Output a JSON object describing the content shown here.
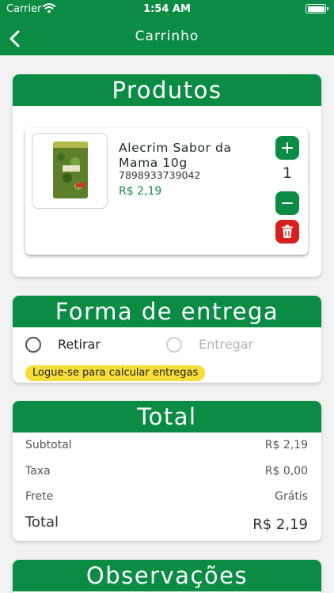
{
  "status_bar": {
    "carrier": "Carrier",
    "time": "1:54 AM"
  },
  "nav": {
    "title": "Carrinho"
  },
  "products_section": {
    "title": "Produtos",
    "items": [
      {
        "name": "Alecrim Sabor da Mama 10g",
        "code": "7898933739042",
        "price": "R$ 2,19",
        "quantity": "1"
      }
    ]
  },
  "delivery_section": {
    "title": "Forma de entrega",
    "options": [
      {
        "label": "Retirar",
        "enabled": true
      },
      {
        "label": "Entregar",
        "enabled": false
      }
    ],
    "login_notice": "Logue-se para calcular entregas"
  },
  "total_section": {
    "title": "Total",
    "rows": [
      {
        "label": "Subtotal",
        "value": "R$ 2,19"
      },
      {
        "label": "Taxa",
        "value": "R$ 0,00"
      },
      {
        "label": "Frete",
        "value": "Grátis"
      }
    ],
    "total": {
      "label": "Total",
      "value": "R$ 2,19"
    }
  },
  "notes_section": {
    "title": "Observações"
  },
  "colors": {
    "primary": "#0b8c44",
    "danger": "#d81f1f",
    "notice": "#f7dd3a"
  }
}
